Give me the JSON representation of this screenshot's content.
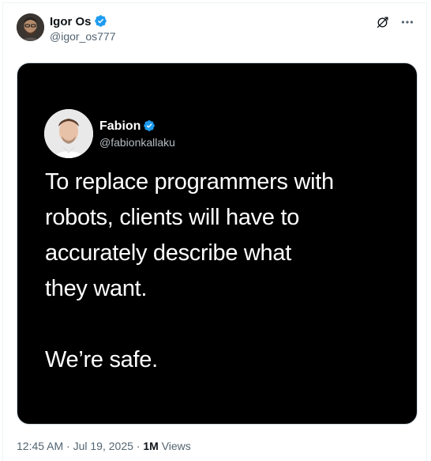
{
  "author": {
    "name": "Igor Os",
    "handle": "@igor_os777",
    "verified": true
  },
  "quoted_image": {
    "author": {
      "name": "Fabion",
      "handle": "@fabionkallaku",
      "verified": true
    },
    "lines": [
      "To replace programmers with",
      "robots, clients will have to",
      "accurately describe what",
      "they want."
    ],
    "closing_line": "We’re safe."
  },
  "meta": {
    "time": "12:45 AM",
    "separator": "·",
    "date": "Jul 19, 2025",
    "views_count": "1M",
    "views_label": "Views"
  },
  "icons": {
    "grok": "grok-icon",
    "more": "more-icon",
    "verified": "verified-badge-icon"
  },
  "colors": {
    "verified_blue": "#1d9bf0",
    "secondary_text": "#536471",
    "media_background": "#000000"
  }
}
